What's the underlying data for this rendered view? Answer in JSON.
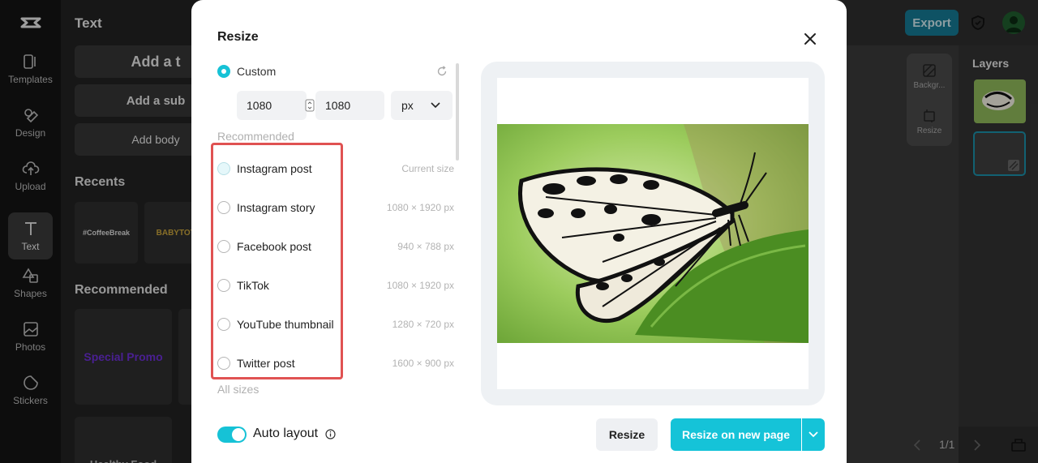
{
  "app": {
    "rail": [
      {
        "label": "Templates",
        "icon": "templates-icon"
      },
      {
        "label": "Design",
        "icon": "design-icon"
      },
      {
        "label": "Upload",
        "icon": "upload-icon"
      },
      {
        "label": "Text",
        "icon": "text-icon",
        "active": true
      },
      {
        "label": "Shapes",
        "icon": "shapes-icon"
      },
      {
        "label": "Photos",
        "icon": "photos-icon"
      },
      {
        "label": "Stickers",
        "icon": "stickers-icon"
      }
    ],
    "panel": {
      "title": "Text",
      "add_title": "Add a t",
      "add_subtitle": "Add a sub",
      "add_body": "Add body",
      "recents_label": "Recents",
      "recent_1": "#CoffeeBreak",
      "recent_2": "BABYTOY",
      "recommended_label": "Recommended",
      "rec_1": "Special Promo",
      "rec_2": "Healthy Food"
    },
    "export_label": "Export",
    "tools": {
      "background": "Backgr...",
      "resize": "Resize"
    },
    "layers_title": "Layers",
    "pager": "1/1"
  },
  "modal": {
    "title": "Resize",
    "custom_label": "Custom",
    "width_value": "1080",
    "height_value": "1080",
    "unit": "px",
    "recommended_label": "Recommended",
    "presets": [
      {
        "name": "Instagram post",
        "size": "Current size"
      },
      {
        "name": "Instagram story",
        "size": "1080 × 1920 px"
      },
      {
        "name": "Facebook post",
        "size": "940 × 788 px"
      },
      {
        "name": "TikTok",
        "size": "1080 × 1920 px"
      },
      {
        "name": "YouTube thumbnail",
        "size": "1280 × 720 px"
      },
      {
        "name": "Twitter post",
        "size": "1600 × 900 px"
      }
    ],
    "all_sizes_label": "All sizes",
    "auto_layout_label": "Auto layout",
    "resize_button": "Resize",
    "resize_new_page_button": "Resize on new page"
  },
  "colors": {
    "accent": "#15c3d8",
    "highlight": "#e05252"
  }
}
